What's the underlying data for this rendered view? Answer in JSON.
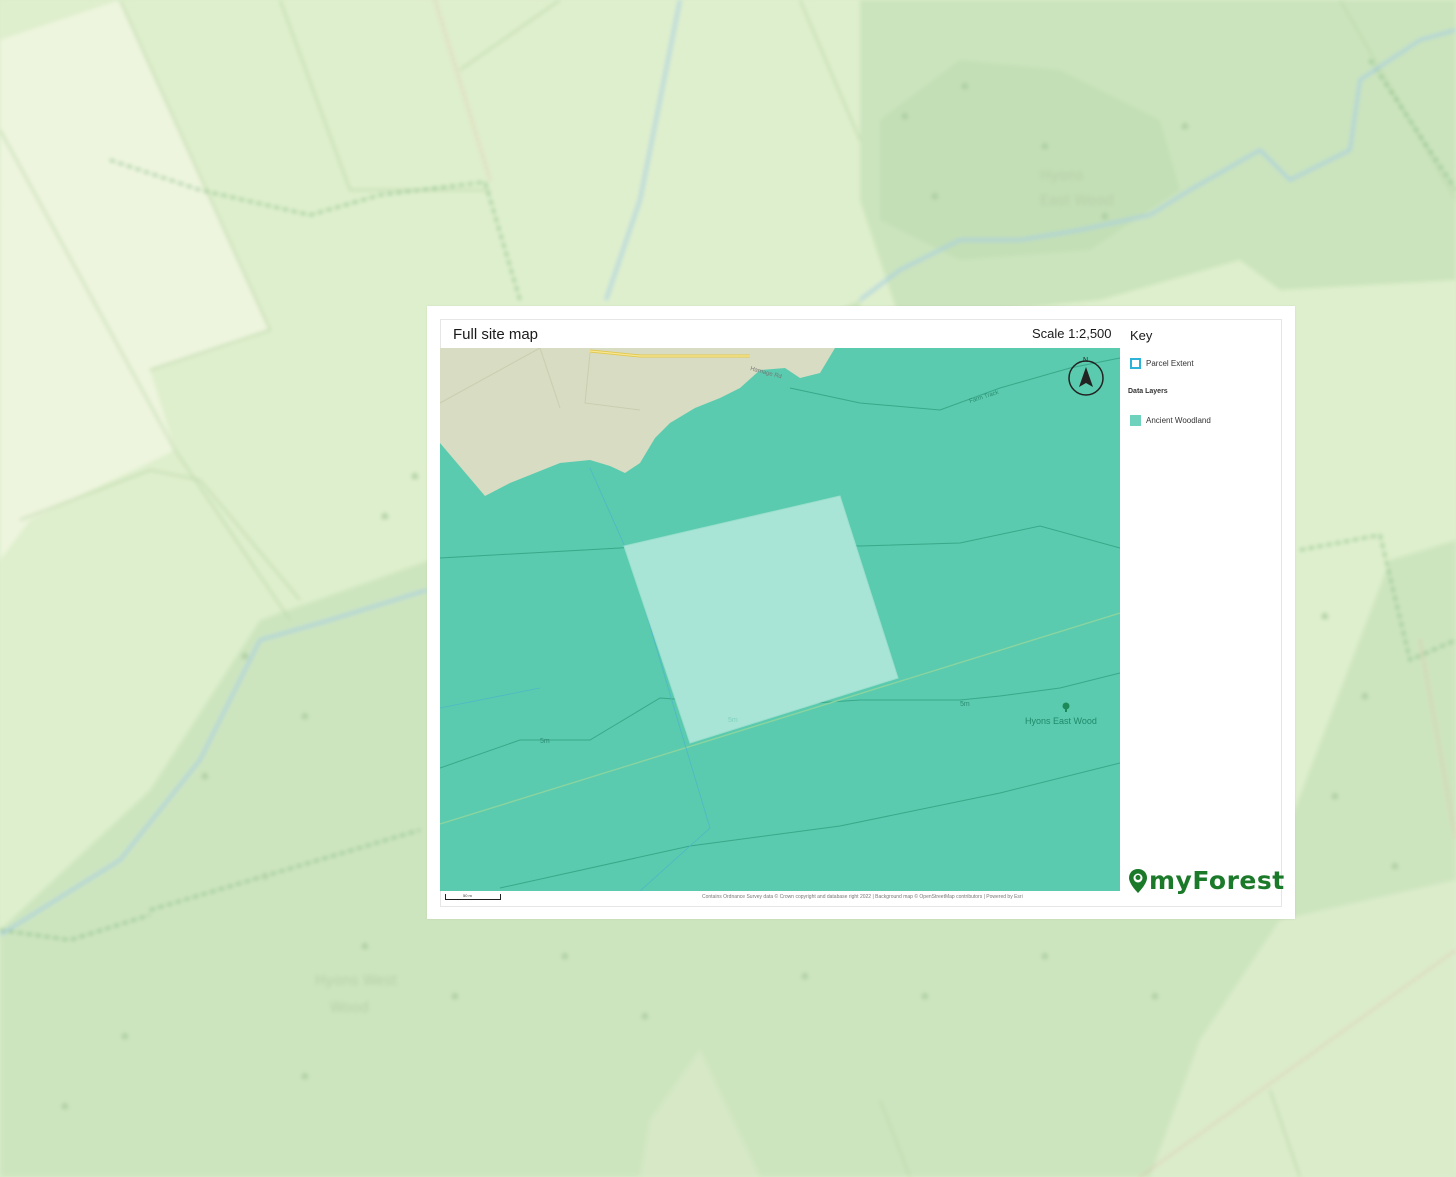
{
  "map": {
    "title": "Full site map",
    "scale_label": "Scale 1:2,500",
    "north_label": "N",
    "place_labels": [
      "Hyons East Wood"
    ],
    "contour_labels": [
      "5m",
      "5m",
      "5m"
    ],
    "road_labels": [
      "Harnage Rd",
      "Farm Track"
    ],
    "scale_bar_label": "50 m",
    "attribution": "Contains Ordnance Survey data © Crown copyright and database right 2022 | Background map © OpenStreetMap contributors | Powered by Esri"
  },
  "key": {
    "title": "Key",
    "items": [
      {
        "label": "Parcel Extent",
        "color": "#2fb2d8"
      },
      {
        "label": "Ancient Woodland",
        "color": "#6fd2bd"
      }
    ],
    "section_label": "Data Layers"
  },
  "brand": {
    "name": "myForest",
    "color": "#1b7a2a"
  },
  "colors": {
    "woodland_fill": "#5acbae",
    "site_fill": "#a8e5d6",
    "background_map": "#dcedcc"
  }
}
